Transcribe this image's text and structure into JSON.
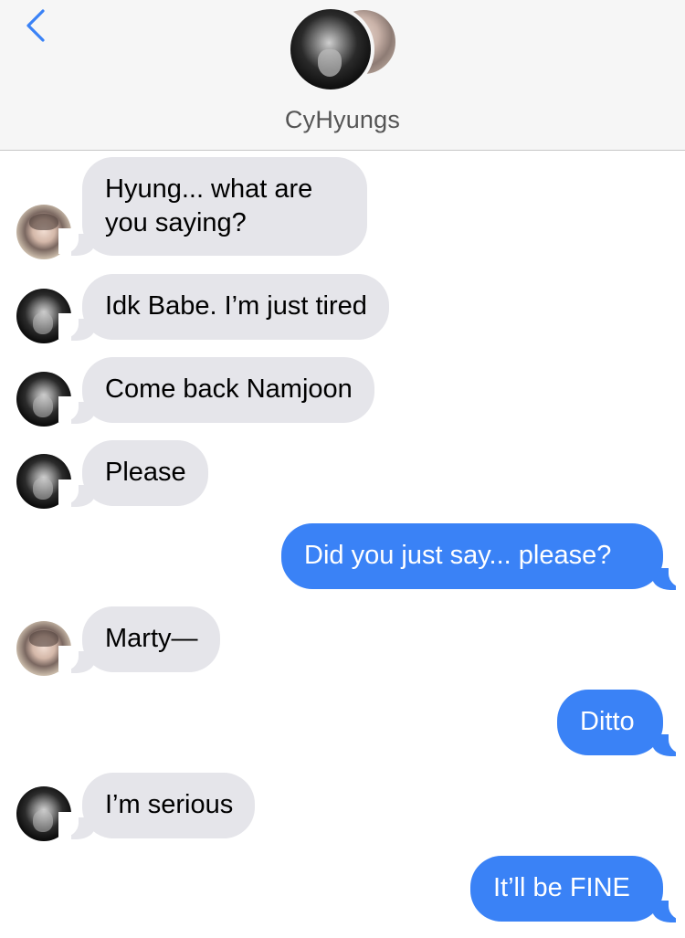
{
  "header": {
    "back_icon": "chevron-left-icon",
    "title": "CyHyungs",
    "accent_color": "#3a82f6"
  },
  "messages": [
    {
      "direction": "incoming",
      "avatar": "light",
      "text": "Hyung... what are you saying?"
    },
    {
      "direction": "incoming",
      "avatar": "dark",
      "text": "Idk Babe. I’m just tired"
    },
    {
      "direction": "incoming",
      "avatar": "dark",
      "text": "Come back Namjoon"
    },
    {
      "direction": "incoming",
      "avatar": "dark",
      "text": "Please"
    },
    {
      "direction": "outgoing",
      "text": "Did you just say... please?"
    },
    {
      "direction": "incoming",
      "avatar": "light",
      "text": "Marty—"
    },
    {
      "direction": "outgoing",
      "text": "Ditto"
    },
    {
      "direction": "incoming",
      "avatar": "dark",
      "text": "I’m serious"
    },
    {
      "direction": "outgoing",
      "text": "It’ll be FINE"
    }
  ]
}
